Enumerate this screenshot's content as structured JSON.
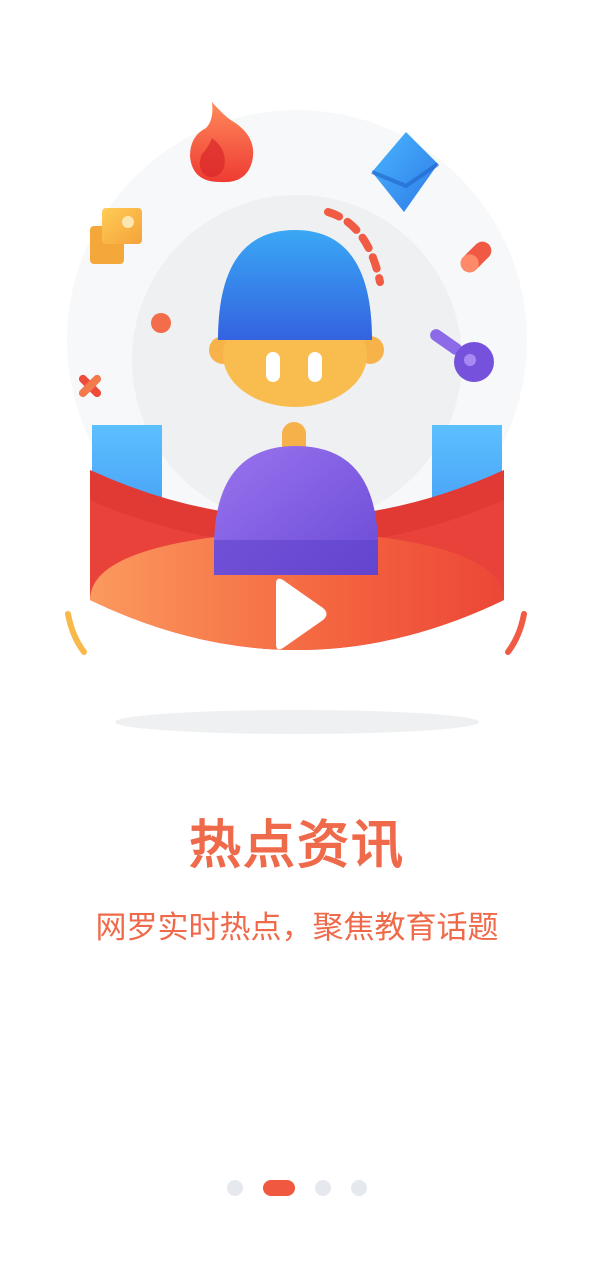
{
  "onboarding": {
    "title": "热点资讯",
    "subtitle": "网罗实时热点，聚焦教育话题"
  },
  "pager": {
    "page_count": 4,
    "active_page": 2
  },
  "colors": {
    "accent": "#ef6a4a",
    "indicator_active": "#f0593f",
    "indicator_inactive": "#e5e8ec",
    "figure_head": "#3b7be6",
    "figure_body": "#7a5ae0",
    "stage_red": "#ef4a3a"
  },
  "icons": [
    "fire-icon",
    "mail-icon",
    "puzzle-icon",
    "pill-icon",
    "whistle-icon",
    "cross-icon",
    "play-icon"
  ]
}
